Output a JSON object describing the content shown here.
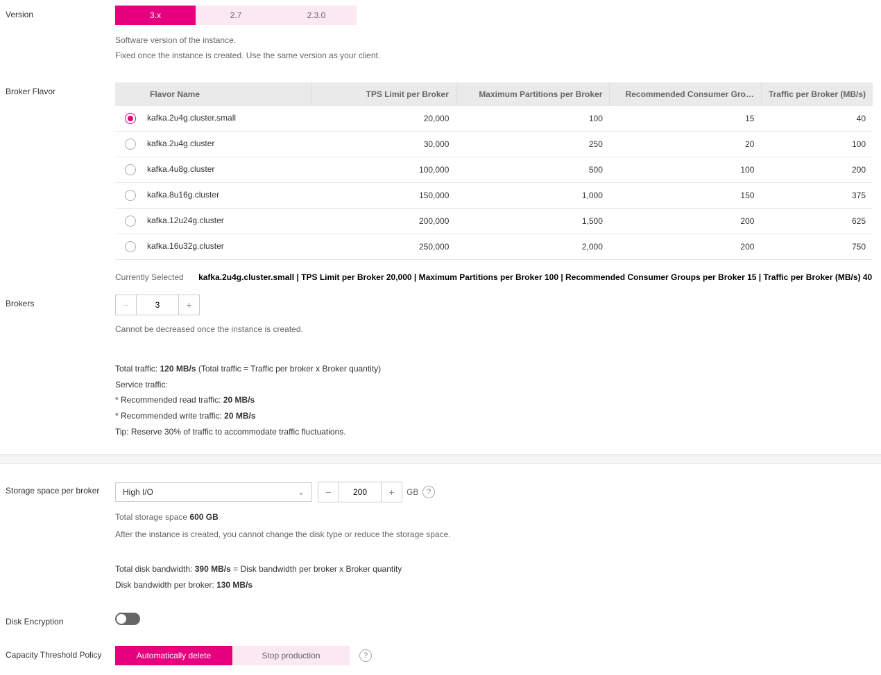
{
  "version": {
    "label": "Version",
    "options": [
      "3.x",
      "2.7",
      "2.3.0"
    ],
    "selected": "3.x",
    "desc1": "Software version of the instance.",
    "desc2": "Fixed once the instance is created. Use the same version as your client."
  },
  "flavor": {
    "label": "Broker Flavor",
    "columns": [
      "Flavor Name",
      "TPS Limit per Broker",
      "Maximum Partitions per Broker",
      "Recommended Consumer Gro…",
      "Traffic per Broker (MB/s)"
    ],
    "rows": [
      {
        "name": "kafka.2u4g.cluster.small",
        "tps": "20,000",
        "parts": "100",
        "groups": "15",
        "traffic": "40",
        "selected": true
      },
      {
        "name": "kafka.2u4g.cluster",
        "tps": "30,000",
        "parts": "250",
        "groups": "20",
        "traffic": "100",
        "selected": false
      },
      {
        "name": "kafka.4u8g.cluster",
        "tps": "100,000",
        "parts": "500",
        "groups": "100",
        "traffic": "200",
        "selected": false
      },
      {
        "name": "kafka.8u16g.cluster",
        "tps": "150,000",
        "parts": "1,000",
        "groups": "150",
        "traffic": "375",
        "selected": false
      },
      {
        "name": "kafka.12u24g.cluster",
        "tps": "200,000",
        "parts": "1,500",
        "groups": "200",
        "traffic": "625",
        "selected": false
      },
      {
        "name": "kafka.16u32g.cluster",
        "tps": "250,000",
        "parts": "2,000",
        "groups": "200",
        "traffic": "750",
        "selected": false
      }
    ],
    "currently_label": "Currently Selected",
    "currently_value": "kafka.2u4g.cluster.small | TPS Limit per Broker 20,000 | Maximum Partitions per Broker 100 | Recommended Consumer Groups per Broker 15 | Traffic per Broker (MB/s) 40"
  },
  "brokers": {
    "label": "Brokers",
    "value": "3",
    "desc": "Cannot be decreased once the instance is created.",
    "total_traffic_prefix": "Total traffic: ",
    "total_traffic_value": "120 MB/s",
    "total_traffic_suffix": " (Total traffic = Traffic per broker x Broker quantity)",
    "service_traffic": "Service traffic:",
    "read_prefix": " * Recommended read traffic: ",
    "read_value": "20 MB/s",
    "write_prefix": " * Recommended write traffic: ",
    "write_value": "20 MB/s",
    "tip": "Tip: Reserve 30% of traffic to accommodate traffic fluctuations."
  },
  "storage": {
    "label": "Storage space per broker",
    "disk_type": "High I/O",
    "size_value": "200",
    "unit": "GB",
    "total_label": "Total storage space  ",
    "total_value": "600 GB",
    "desc": "After the instance is created, you cannot change the disk type or reduce the storage space.",
    "bw_prefix": "Total disk bandwidth: ",
    "bw_value": "390 MB/s",
    "bw_suffix": " = Disk bandwidth per broker x Broker quantity",
    "bw_per_prefix": "Disk bandwidth per broker: ",
    "bw_per_value": "130 MB/s"
  },
  "disk_encryption": {
    "label": "Disk Encryption",
    "enabled": false
  },
  "capacity": {
    "label": "Capacity Threshold Policy",
    "options": [
      "Automatically delete",
      "Stop production"
    ],
    "selected": "Automatically delete"
  }
}
